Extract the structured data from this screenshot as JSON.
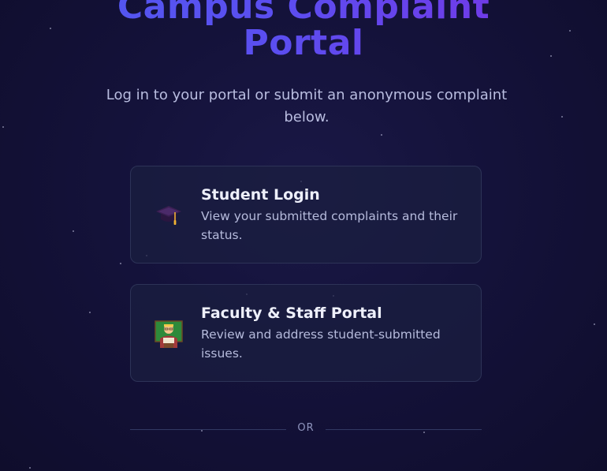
{
  "header": {
    "title_line1": "Campus Complaint",
    "title_line2": "Portal",
    "subtitle": "Log in to your portal or submit an anonymous complaint below."
  },
  "cards": [
    {
      "title": "Student Login",
      "description": "View your submitted complaints and their status.",
      "icon": "graduation-cap-icon"
    },
    {
      "title": "Faculty & Staff Portal",
      "description": "Review and address student-submitted issues.",
      "icon": "teacher-icon"
    }
  ],
  "divider": {
    "label": "OR"
  }
}
